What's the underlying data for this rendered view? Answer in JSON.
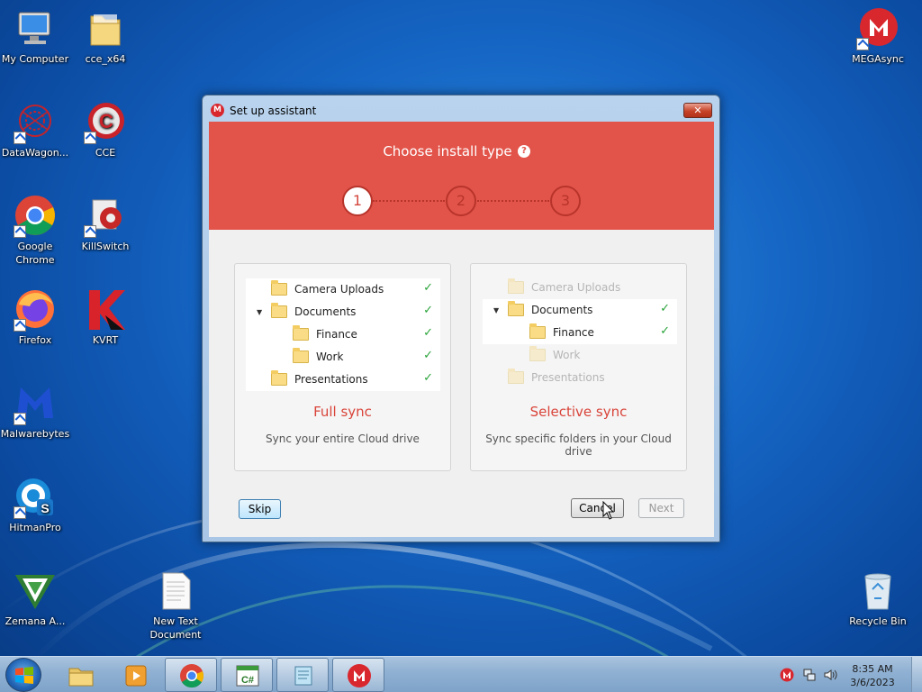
{
  "desktop": {
    "icons": [
      {
        "label": "My Computer"
      },
      {
        "label": "cce_x64"
      },
      {
        "label": "DataWagon..."
      },
      {
        "label": "CCE"
      },
      {
        "label": "Google Chrome"
      },
      {
        "label": "KillSwitch"
      },
      {
        "label": "Firefox"
      },
      {
        "label": "KVRT"
      },
      {
        "label": "Malwarebytes"
      },
      {
        "label": "HitmanPro"
      },
      {
        "label": "Zemana A..."
      },
      {
        "label": "New Text Document"
      },
      {
        "label": "MEGAsync"
      },
      {
        "label": "Recycle Bin"
      }
    ]
  },
  "window": {
    "title": "Set up assistant",
    "close_glyph": "✕",
    "logo_letter": "M",
    "header": {
      "title": "Choose install type",
      "help_glyph": "?",
      "steps": [
        "1",
        "2",
        "3"
      ]
    },
    "full_sync": {
      "title": "Full sync",
      "description": "Sync your entire Cloud drive",
      "tree": [
        "Camera Uploads",
        "Documents",
        "Finance",
        "Work",
        "Presentations"
      ]
    },
    "selective_sync": {
      "title": "Selective sync",
      "description": "Sync specific folders in your Cloud drive",
      "tree": [
        "Camera Uploads",
        "Documents",
        "Finance",
        "Work",
        "Presentations"
      ]
    },
    "buttons": {
      "skip": "Skip",
      "cancel": "Cancel",
      "next": "Next"
    }
  },
  "taskbar": {
    "clock_time": "8:35 AM",
    "clock_date": "3/6/2023"
  },
  "colors": {
    "accent": "#e2544a",
    "check": "#2aa33a"
  }
}
